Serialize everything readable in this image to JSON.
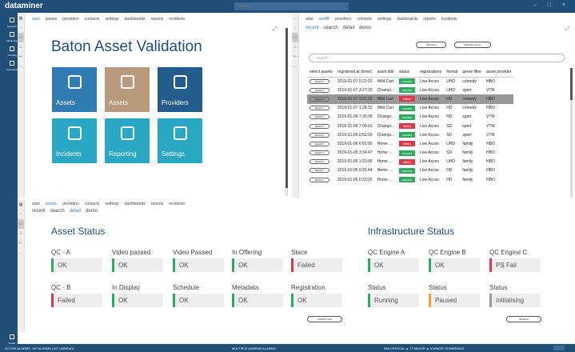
{
  "app": {
    "brand": "dataminer",
    "search_placeholder": "Search",
    "window_controls": "– □ ×"
  },
  "rail": [
    {
      "name": "surveyor",
      "label": "Surveyor"
    },
    {
      "name": "monitoring",
      "label": "Monitoring"
    },
    {
      "name": "trending",
      "label": "Trending"
    },
    {
      "name": "automation",
      "label": "Automation"
    },
    {
      "name": "profile",
      "label": "Profile"
    }
  ],
  "pane1": {
    "crumbs": [
      "start",
      "assets",
      "providers",
      "contacts",
      "settings",
      "dashboards",
      "reports",
      "incidents"
    ],
    "title": "Baton Asset Validation",
    "tiles": [
      "Assets",
      "Assets",
      "Providers",
      "Incidents",
      "Reporting",
      "Settings"
    ]
  },
  "pane2": {
    "crumbs": [
      "start",
      "assffff",
      "providers",
      "contacts",
      "settings",
      "dashboards",
      "reports",
      "incidents"
    ],
    "tabs": [
      "recent",
      "search",
      "detail",
      "demo"
    ],
    "btn_details": "DETAILS",
    "btn_search_all": "SEARCH IN ALL",
    "search_placeholder": "search",
    "columns": [
      "select assets",
      "registered at (timer)",
      "asset title",
      "status",
      "registrations",
      "fromat",
      "genre filter",
      "asset provider"
    ],
    "select_label": "SELECT",
    "rows": [
      [
        "2019-01-07 5:22:23",
        "Wild Cart",
        "succes",
        "Live Acces",
        "UHD",
        "comedy",
        "HBO"
      ],
      [
        "2019-01-07 3:27:20",
        "Champi...",
        "succes",
        "Live Acces",
        "UHD",
        "sport",
        "VTM"
      ],
      [
        "2019-01-07 3:22:02",
        "Wild Cart",
        "failed",
        "Live Acces",
        "HD",
        "comedy",
        "HBO"
      ],
      [
        "2019-01-07 1:28:33",
        "Wild Cart",
        "succes",
        "Live Acces",
        "HD",
        "comedy",
        "HBO"
      ],
      [
        "2019-01-06 7:35:09",
        "Champi...",
        "succes",
        "Live Acces",
        "HD",
        "sport",
        "VTM"
      ],
      [
        "2019-01-06 7:00:01",
        "Champi...",
        "failed",
        "Live Acces",
        "SD",
        "sport",
        "VTM"
      ],
      [
        "2019-01-06 6:52:19",
        "Champi...",
        "succes",
        "Live Acces",
        "SD",
        "sport",
        "VTM"
      ],
      [
        "2019-01-06 6:02:00",
        "Home ...",
        "failed",
        "Live Acces",
        "UHD",
        "family",
        "HBO"
      ],
      [
        "2019-01-05 3:34:47",
        "Home ...",
        "succes",
        "Live Acces",
        "SD",
        "family",
        "HBO"
      ],
      [
        "2019-01-05 1:22:66",
        "Home ...",
        "failed",
        "Live Acces",
        "UHD",
        "family",
        "HBO"
      ],
      [
        "2019-01-05 0:25:44",
        "Home ...",
        "succes",
        "Live Acces",
        "HD",
        "family",
        "HBO"
      ],
      [
        "2019-01-05 0:22:02",
        "Home ...",
        "succes",
        "Live Acces",
        "HD",
        "family",
        "HBO"
      ]
    ]
  },
  "pane3": {
    "crumbs": [
      "start",
      "assets",
      "providers",
      "contacts",
      "settings",
      "dashboards",
      "reports",
      "incidents"
    ],
    "tabs": [
      "recent",
      "search",
      "detail",
      "demo"
    ],
    "asset_status_title": "Asset Status",
    "infra_title": "Infrastructure Status",
    "btn_workflow": "WORKFLOW",
    "btn_search": "SEARCH",
    "asset_fields": [
      {
        "label": "QC - A",
        "value": "OK",
        "state": "ok"
      },
      {
        "label": "Video passed",
        "value": "OK",
        "state": "ok"
      },
      {
        "label": "Video Passed",
        "value": "OK",
        "state": "ok"
      },
      {
        "label": "In Offering",
        "value": "OK",
        "state": "ok"
      },
      {
        "label": "Stace",
        "value": "Failed",
        "state": "red"
      },
      {
        "label": "QC - B",
        "value": "Failed",
        "state": "red"
      },
      {
        "label": "In Display",
        "value": "OK",
        "state": "ok"
      },
      {
        "label": "Schedule",
        "value": "OK",
        "state": "ok"
      },
      {
        "label": "Metadata",
        "value": "OK",
        "state": "ok"
      },
      {
        "label": "Registration",
        "value": "OK",
        "state": "ok"
      }
    ],
    "infra_fields": [
      {
        "label": "QC Engine A",
        "value": "OK",
        "state": "ok"
      },
      {
        "label": "QC Engine B",
        "value": "OK",
        "state": "ok"
      },
      {
        "label": "QC Engine C",
        "value": "PS Fail",
        "state": "red"
      },
      {
        "label": "Status",
        "value": "Running",
        "state": "ok"
      },
      {
        "label": "Status",
        "value": "Paused",
        "state": "orange"
      },
      {
        "label": "Status",
        "value": "Initialising",
        "state": "grey"
      }
    ]
  },
  "statusbar": {
    "left": "ACTIVE ALARMS: 167 ALARMS (167 UNREAD)",
    "mid": "MULTIPLE UNREAD ALARMS",
    "right": "966 CRITICAL   ▲ 77 MAJOR   ▲ 5 MINOR   78 WARNING"
  }
}
